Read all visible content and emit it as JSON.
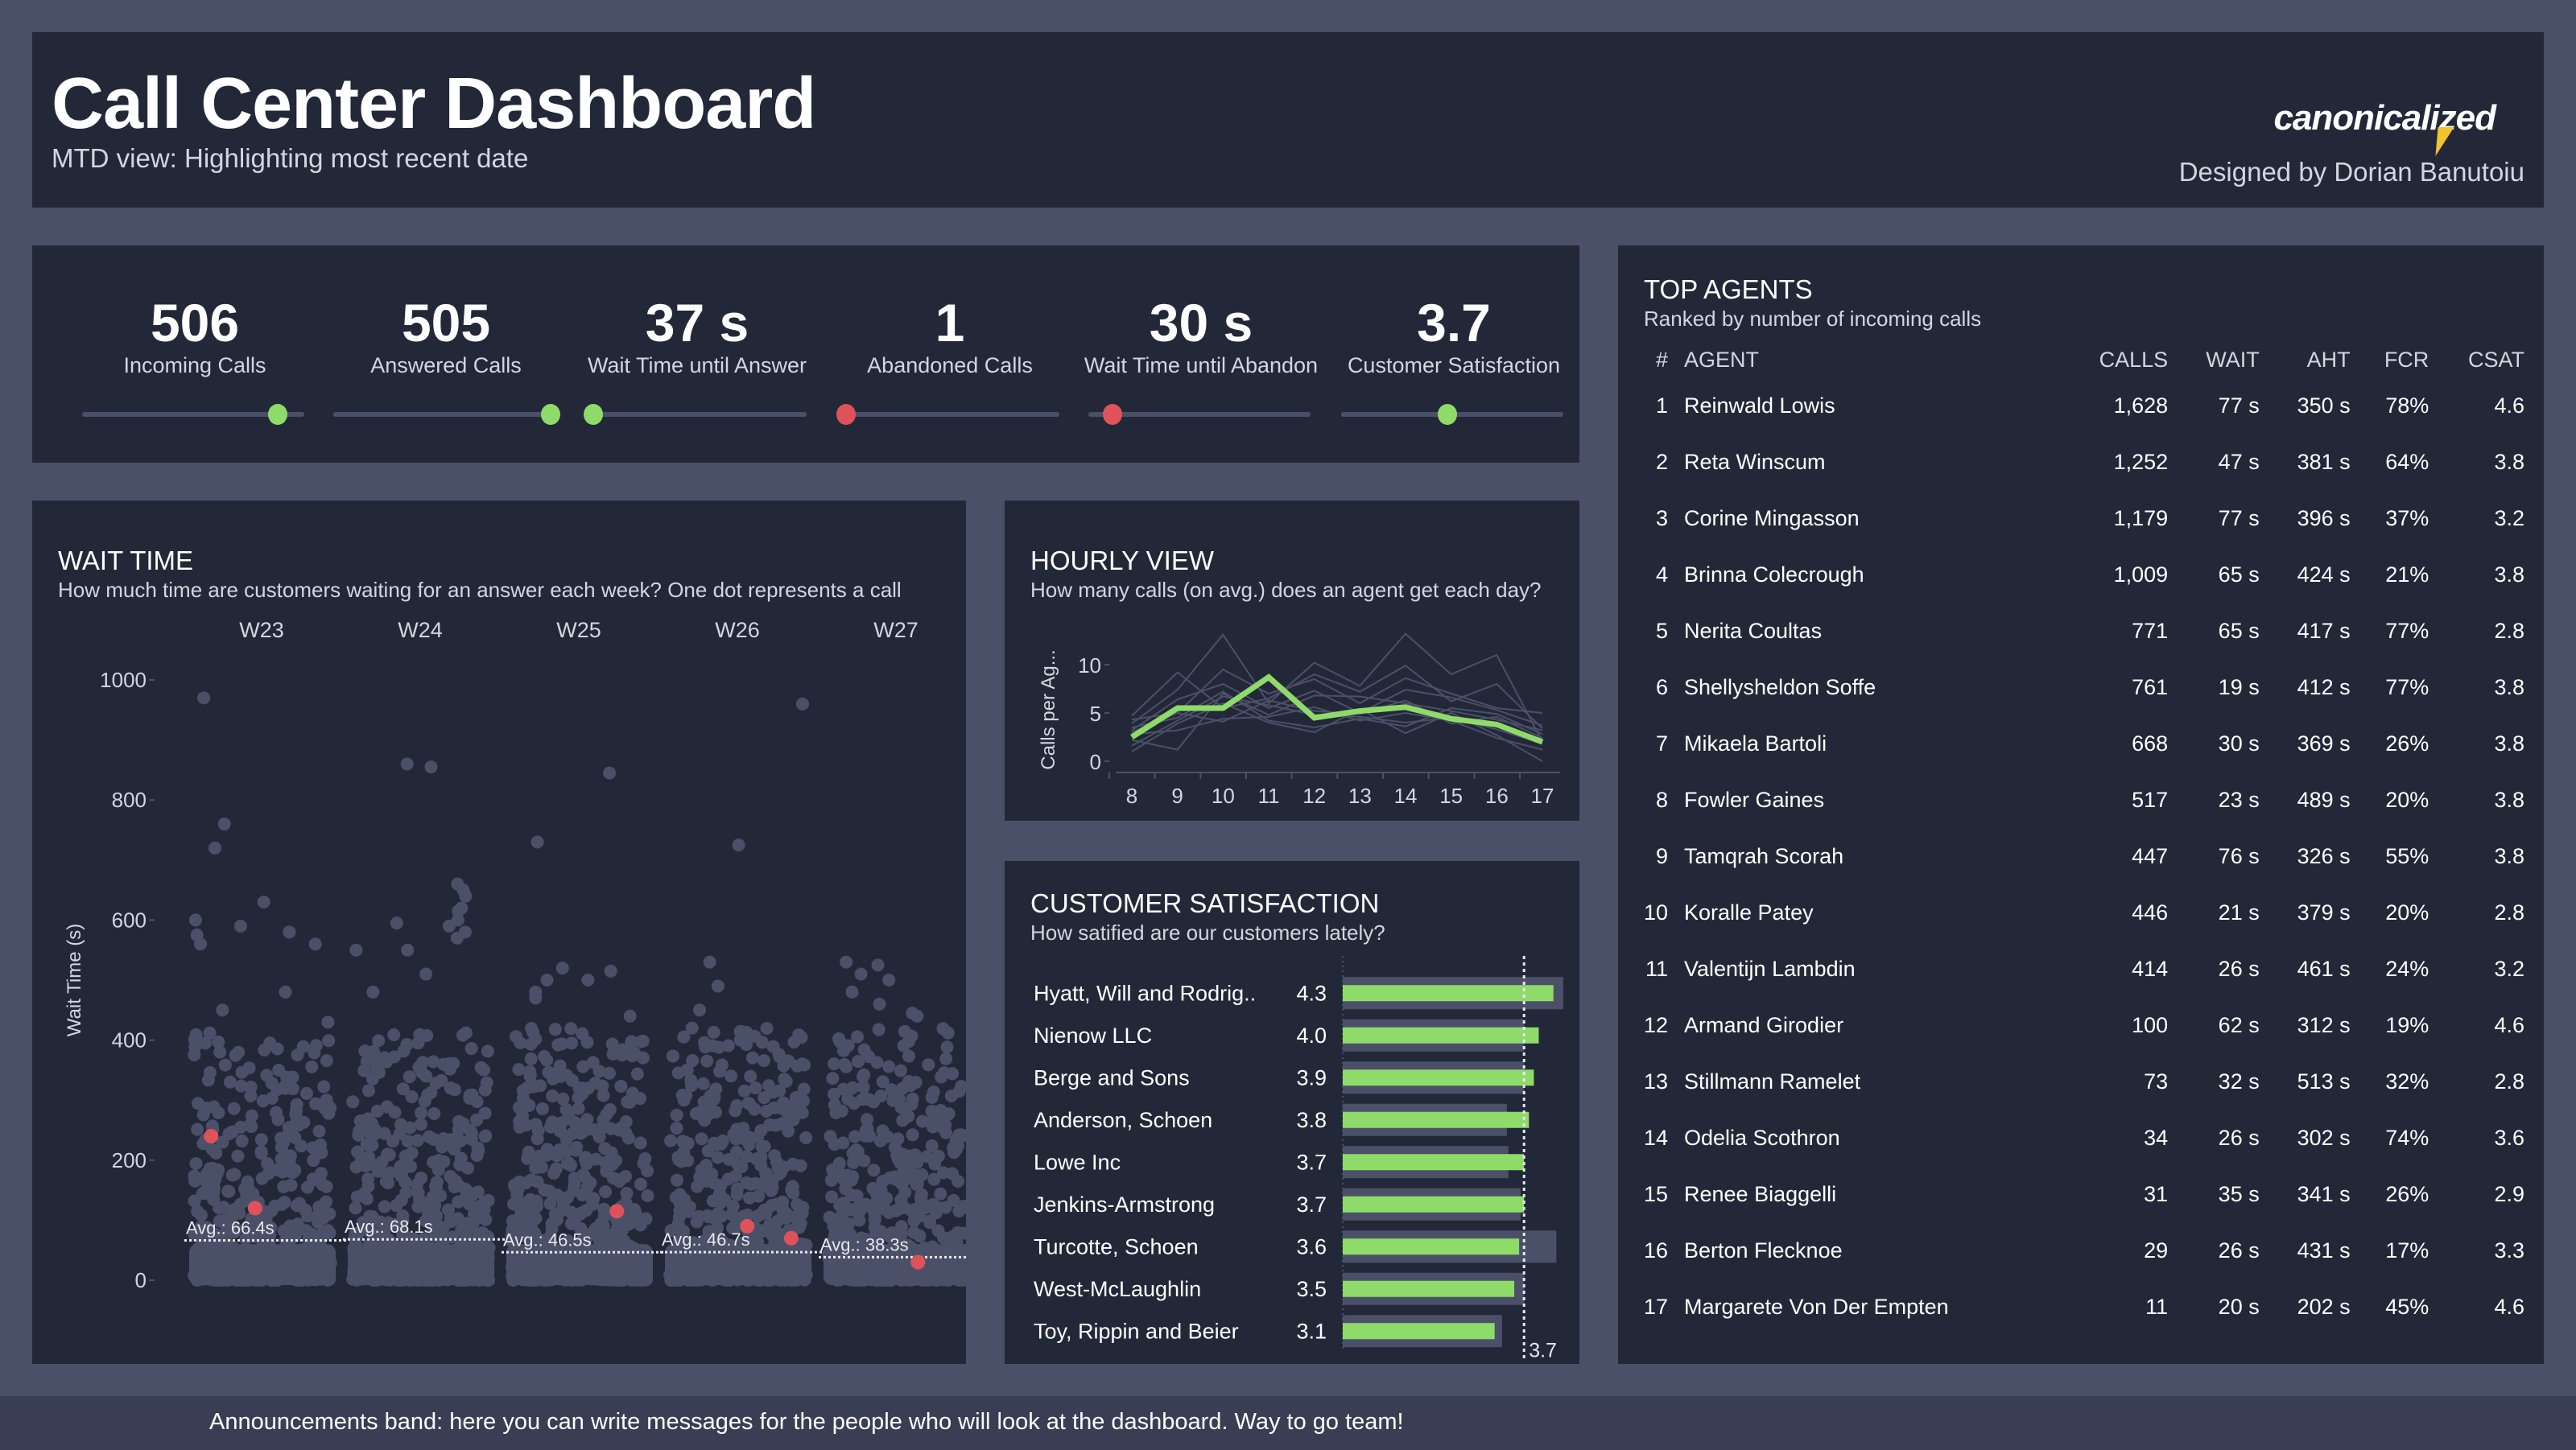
{
  "header": {
    "title": "Call Center Dashboard",
    "subtitle": "MTD view: Highlighting most recent date",
    "logo_text": "canonicalized",
    "designer": "Designed by Dorian Banutoiu"
  },
  "colors": {
    "background": "#4b5069",
    "card": "#232839",
    "good": "#8fdb69",
    "bad": "#e0525a",
    "muted": "#4b5069",
    "text": "#ffffff",
    "subtext": "#d4d6de",
    "band": "#393e55"
  },
  "kpis": [
    {
      "value": "506",
      "label": "Incoming Calls",
      "indicator_position": 0.88,
      "status": "good"
    },
    {
      "value": "505",
      "label": "Answered Calls",
      "indicator_position": 0.98,
      "status": "good"
    },
    {
      "value": "37 s",
      "label": "Wait Time until Answer",
      "indicator_position": 0.04,
      "status": "good"
    },
    {
      "value": "1",
      "label": "Abandoned Calls",
      "indicator_position": 0.04,
      "status": "bad"
    },
    {
      "value": "30 s",
      "label": "Wait Time until Abandon",
      "indicator_position": 0.11,
      "status": "bad"
    },
    {
      "value": "3.7",
      "label": "Customer Satisfaction",
      "indicator_position": 0.48,
      "status": "good"
    }
  ],
  "wait_time": {
    "title": "WAIT TIME",
    "subtitle": "How much time are customers waiting  for an answer each week? One dot represents a call"
  },
  "hourly": {
    "title": "HOURLY VIEW",
    "subtitle": "How many calls (on avg.) does an agent get each day?"
  },
  "csat": {
    "title": "CUSTOMER SATISFACTION",
    "subtitle": "How satified are our customers lately?"
  },
  "chart_data": [
    {
      "type": "scatter",
      "name": "wait-time",
      "title": "WAIT TIME",
      "ylabel": "Wait Time (s)",
      "xlabel": "",
      "categories": [
        "W23",
        "W24",
        "W25",
        "W26",
        "W27"
      ],
      "ylim": [
        0,
        1000
      ],
      "yticks": [
        0,
        200,
        400,
        600,
        800,
        1000
      ],
      "averages": [
        66.4,
        68.1,
        46.5,
        46.7,
        38.3
      ],
      "average_labels": [
        "Avg.: 66.4s",
        "Avg.: 68.1s",
        "Avg.: 46.5s",
        "Avg.: 46.7s",
        "Avg.: 38.3s"
      ],
      "outliers": [
        {
          "week": "W23",
          "values": [
            970,
            760,
            720,
            630,
            600,
            590,
            580,
            575,
            560,
            560,
            480,
            450,
            430
          ]
        },
        {
          "week": "W24",
          "values": [
            860,
            855,
            660,
            650,
            640,
            620,
            615,
            600,
            595,
            590,
            580,
            570,
            550,
            550,
            510,
            480
          ]
        },
        {
          "week": "W25",
          "values": [
            845,
            730,
            520,
            515,
            500,
            500,
            480,
            470,
            440
          ]
        },
        {
          "week": "W26",
          "values": [
            960,
            725,
            530,
            490,
            450,
            420
          ]
        },
        {
          "week": "W27",
          "values": [
            530,
            525,
            510,
            500,
            480,
            460,
            445,
            440
          ]
        }
      ],
      "highlighted_calls": [
        {
          "week": "W23",
          "values": [
            240,
            120
          ]
        },
        {
          "week": "W25",
          "values": [
            115
          ]
        },
        {
          "week": "W26",
          "values": [
            90,
            70
          ]
        },
        {
          "week": "W27",
          "values": [
            30
          ]
        }
      ]
    },
    {
      "type": "line",
      "name": "hourly-view",
      "title": "HOURLY VIEW",
      "ylabel": "Calls per Ag...",
      "x": [
        8,
        9,
        10,
        11,
        12,
        13,
        14,
        15,
        16,
        17
      ],
      "ylim": [
        0,
        13
      ],
      "yticks": [
        0,
        5,
        10
      ],
      "highlight_series": {
        "name": "Most recent date",
        "values": [
          2.5,
          5.5,
          5.5,
          8.7,
          4.5,
          5.2,
          5.6,
          4.4,
          3.8,
          2.0
        ]
      },
      "background_series": [
        {
          "values": [
            4.7,
            9.2,
            5.5,
            6.5,
            9.0,
            7.2,
            9.9,
            6.2,
            8.0,
            3.4
          ]
        },
        {
          "values": [
            3.9,
            7.4,
            13.1,
            6.0,
            10.2,
            7.8,
            13.2,
            9.0,
            11.0,
            2.0
          ]
        },
        {
          "values": [
            4.3,
            5.0,
            9.5,
            7.0,
            8.5,
            6.0,
            8.6,
            7.0,
            5.5,
            5.0
          ]
        },
        {
          "values": [
            3.2,
            6.4,
            8.0,
            5.5,
            7.3,
            5.0,
            7.4,
            6.6,
            5.3,
            3.7
          ]
        },
        {
          "values": [
            2.2,
            1.2,
            7.0,
            4.8,
            6.8,
            6.7,
            6.0,
            5.2,
            4.3,
            3.2
          ]
        },
        {
          "values": [
            3.5,
            4.5,
            7.2,
            4.2,
            3.5,
            4.4,
            3.6,
            5.5,
            4.9,
            2.8
          ]
        },
        {
          "values": [
            1.0,
            3.9,
            6.0,
            4.0,
            3.0,
            5.4,
            2.9,
            5.0,
            2.7,
            0.0
          ]
        },
        {
          "values": [
            2.8,
            3.2,
            4.4,
            4.6,
            5.6,
            4.2,
            5.0,
            4.2,
            2.4,
            1.2
          ]
        },
        {
          "values": [
            1.6,
            4.2,
            6.7,
            5.8,
            4.8,
            4.6,
            4.0,
            4.5,
            3.3,
            1.8
          ]
        },
        {
          "values": [
            3.0,
            5.0,
            4.1,
            6.3,
            5.2,
            4.9,
            6.3,
            3.9,
            4.6,
            2.4
          ]
        }
      ]
    },
    {
      "type": "bar",
      "name": "customer-satisfaction",
      "title": "CUSTOMER SATISFACTION",
      "orientation": "horizontal",
      "categories": [
        "Hyatt, Will and Rodrig..",
        "Nienow LLC",
        "Berge and Sons",
        "Anderson, Schoen",
        "Lowe Inc",
        "Jenkins-Armstrong",
        "Turcotte, Schoen",
        "West-McLaughlin",
        "Toy, Rippin and Beier"
      ],
      "values": [
        4.3,
        4.0,
        3.9,
        3.8,
        3.7,
        3.7,
        3.6,
        3.5,
        3.1
      ],
      "value_labels": [
        "4.3",
        "4.0",
        "3.9",
        "3.8",
        "3.7",
        "3.7",
        "3.6",
        "3.5",
        "3.1"
      ],
      "background_values": [
        4.5,
        3.7,
        3.7,
        3.35,
        3.38,
        3.63,
        4.36,
        3.7,
        3.25
      ],
      "reference_line": 3.7,
      "reference_label": "3.7",
      "xlim": [
        0,
        4.6
      ]
    }
  ],
  "agents": {
    "title": "TOP AGENTS",
    "subtitle": "Ranked by number of incoming calls",
    "columns": [
      "#",
      "AGENT",
      "CALLS",
      "WAIT",
      "AHT",
      "FCR",
      "CSAT"
    ],
    "rows": [
      [
        "1",
        "Reinwald Lowis",
        "1,628",
        "77 s",
        "350 s",
        "78%",
        "4.6"
      ],
      [
        "2",
        "Reta Winscum",
        "1,252",
        "47 s",
        "381 s",
        "64%",
        "3.8"
      ],
      [
        "3",
        "Corine Mingasson",
        "1,179",
        "77 s",
        "396 s",
        "37%",
        "3.2"
      ],
      [
        "4",
        "Brinna Colecrough",
        "1,009",
        "65 s",
        "424 s",
        "21%",
        "3.8"
      ],
      [
        "5",
        "Nerita Coultas",
        "771",
        "65 s",
        "417 s",
        "77%",
        "2.8"
      ],
      [
        "6",
        "Shellysheldon Soffe",
        "761",
        "19 s",
        "412 s",
        "77%",
        "3.8"
      ],
      [
        "7",
        "Mikaela Bartoli",
        "668",
        "30 s",
        "369 s",
        "26%",
        "3.8"
      ],
      [
        "8",
        "Fowler Gaines",
        "517",
        "23 s",
        "489 s",
        "20%",
        "3.8"
      ],
      [
        "9",
        "Tamqrah Scorah",
        "447",
        "76 s",
        "326 s",
        "55%",
        "3.8"
      ],
      [
        "10",
        "Koralle Patey",
        "446",
        "21 s",
        "379 s",
        "20%",
        "2.8"
      ],
      [
        "11",
        "Valentijn Lambdin",
        "414",
        "26 s",
        "461 s",
        "24%",
        "3.2"
      ],
      [
        "12",
        "Armand Girodier",
        "100",
        "62 s",
        "312 s",
        "19%",
        "4.6"
      ],
      [
        "13",
        "Stillmann Ramelet",
        "73",
        "32 s",
        "513 s",
        "32%",
        "2.8"
      ],
      [
        "14",
        "Odelia Scothron",
        "34",
        "26 s",
        "302 s",
        "74%",
        "3.6"
      ],
      [
        "15",
        "Renee Biaggelli",
        "31",
        "35 s",
        "341 s",
        "26%",
        "2.9"
      ],
      [
        "16",
        "Berton Flecknoe",
        "29",
        "26 s",
        "431 s",
        "17%",
        "3.3"
      ],
      [
        "17",
        "Margarete Von Der Empten",
        "11",
        "20 s",
        "202 s",
        "45%",
        "4.6"
      ]
    ]
  },
  "announcement": "Announcements band: here you can write messages for the people who will look at the dashboard. Way to go team!"
}
